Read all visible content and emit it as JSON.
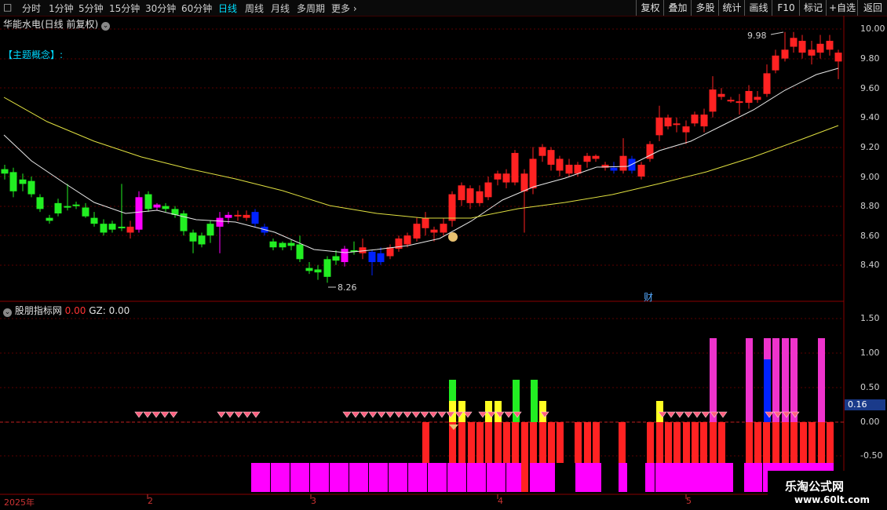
{
  "toolbar": {
    "menu_icon": "□",
    "periods": [
      "分时",
      "1分钟",
      "5分钟",
      "15分钟",
      "30分钟",
      "60分钟",
      "日线",
      "周线",
      "月线",
      "多周期",
      "更多 ›"
    ],
    "active_period": "日线",
    "right_buttons": [
      "复权",
      "叠加",
      "多股",
      "统计",
      "画线",
      "F10",
      "标记",
      "+自选",
      "返回"
    ]
  },
  "main_chart": {
    "title": "华能水电(日线 前复权)",
    "concept_label": "【主题概念】:",
    "high_label": "9.98",
    "low_label": "8.26",
    "cai_marker": "财",
    "y_ticks": [
      "10.00",
      "9.80",
      "9.60",
      "9.40",
      "9.20",
      "9.00",
      "8.80",
      "8.60",
      "8.40"
    ]
  },
  "indicator": {
    "title": "股朋指标网",
    "value1": "0.00",
    "gz_label": "GZ: 0.00",
    "y_ticks": [
      "1.50",
      "1.00",
      "0.50",
      "0.00",
      "-0.50"
    ],
    "current_value": "0.16"
  },
  "date_axis": {
    "labels": [
      "2025年",
      "2",
      "3",
      "4",
      "5"
    ]
  },
  "watermark": {
    "line1": "乐淘公式网",
    "line2": "www.60lt.com"
  },
  "colors": {
    "up": "#ff2222",
    "down": "#22ee22",
    "magenta": "#ff00ff",
    "blue": "#0022ff",
    "ma_white": "#e8e8e8",
    "ma_yellow": "#e0e040"
  }
}
